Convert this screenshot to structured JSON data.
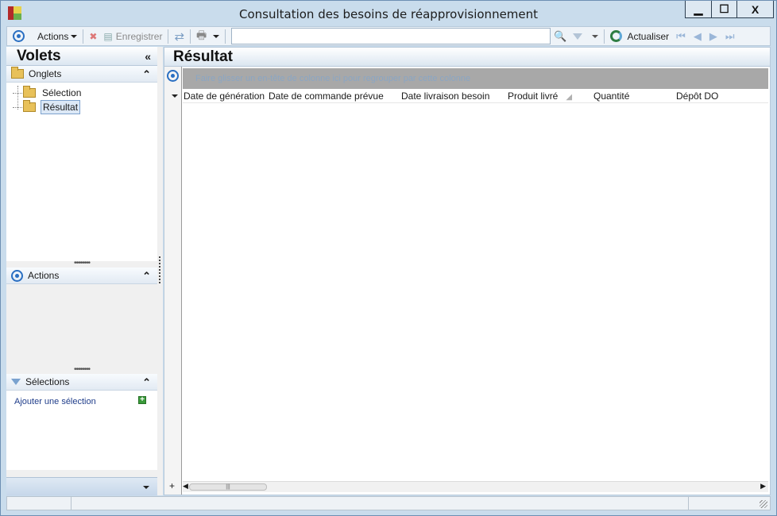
{
  "window": {
    "title": "Consultation des besoins de réapprovisionnement",
    "controls": {
      "minimize": "▁",
      "maximize": "☐",
      "close": "X"
    }
  },
  "toolbar": {
    "actions_label": "Actions",
    "save_label": "Enregistrer",
    "search_value": "",
    "refresh_label": "Actualiser",
    "icons": [
      "target-icon",
      "delete-icon",
      "save-icon",
      "sync-icon",
      "print-icon",
      "search-icon",
      "filter-icon",
      "refresh-icon",
      "first-icon",
      "previous-icon",
      "next-icon",
      "last-icon"
    ]
  },
  "left_panel": {
    "title": "Volets",
    "collapse_glyph": "«",
    "tabs_section": {
      "title": "Onglets",
      "items": [
        {
          "label": "Sélection",
          "selected": false
        },
        {
          "label": "Résultat",
          "selected": true
        }
      ]
    },
    "actions_section": {
      "title": "Actions"
    },
    "selections_section": {
      "title": "Sélections",
      "add_link": "Ajouter une sélection"
    },
    "section_chevron": "⌃"
  },
  "result_panel": {
    "title": "Résultat",
    "group_hint": "Faire glisser un en-tête de colonne ici pour regrouper par cette colonne",
    "columns": [
      "Date de génération",
      "Date de commande prévue",
      "Date livraison besoin",
      "Produit livré",
      "Quantité",
      "Dépôt DO"
    ],
    "rows": []
  },
  "colors": {
    "window_frame": "#c9dcec",
    "accent": "#2a6fc2",
    "group_bar": "#a8a8a8"
  }
}
